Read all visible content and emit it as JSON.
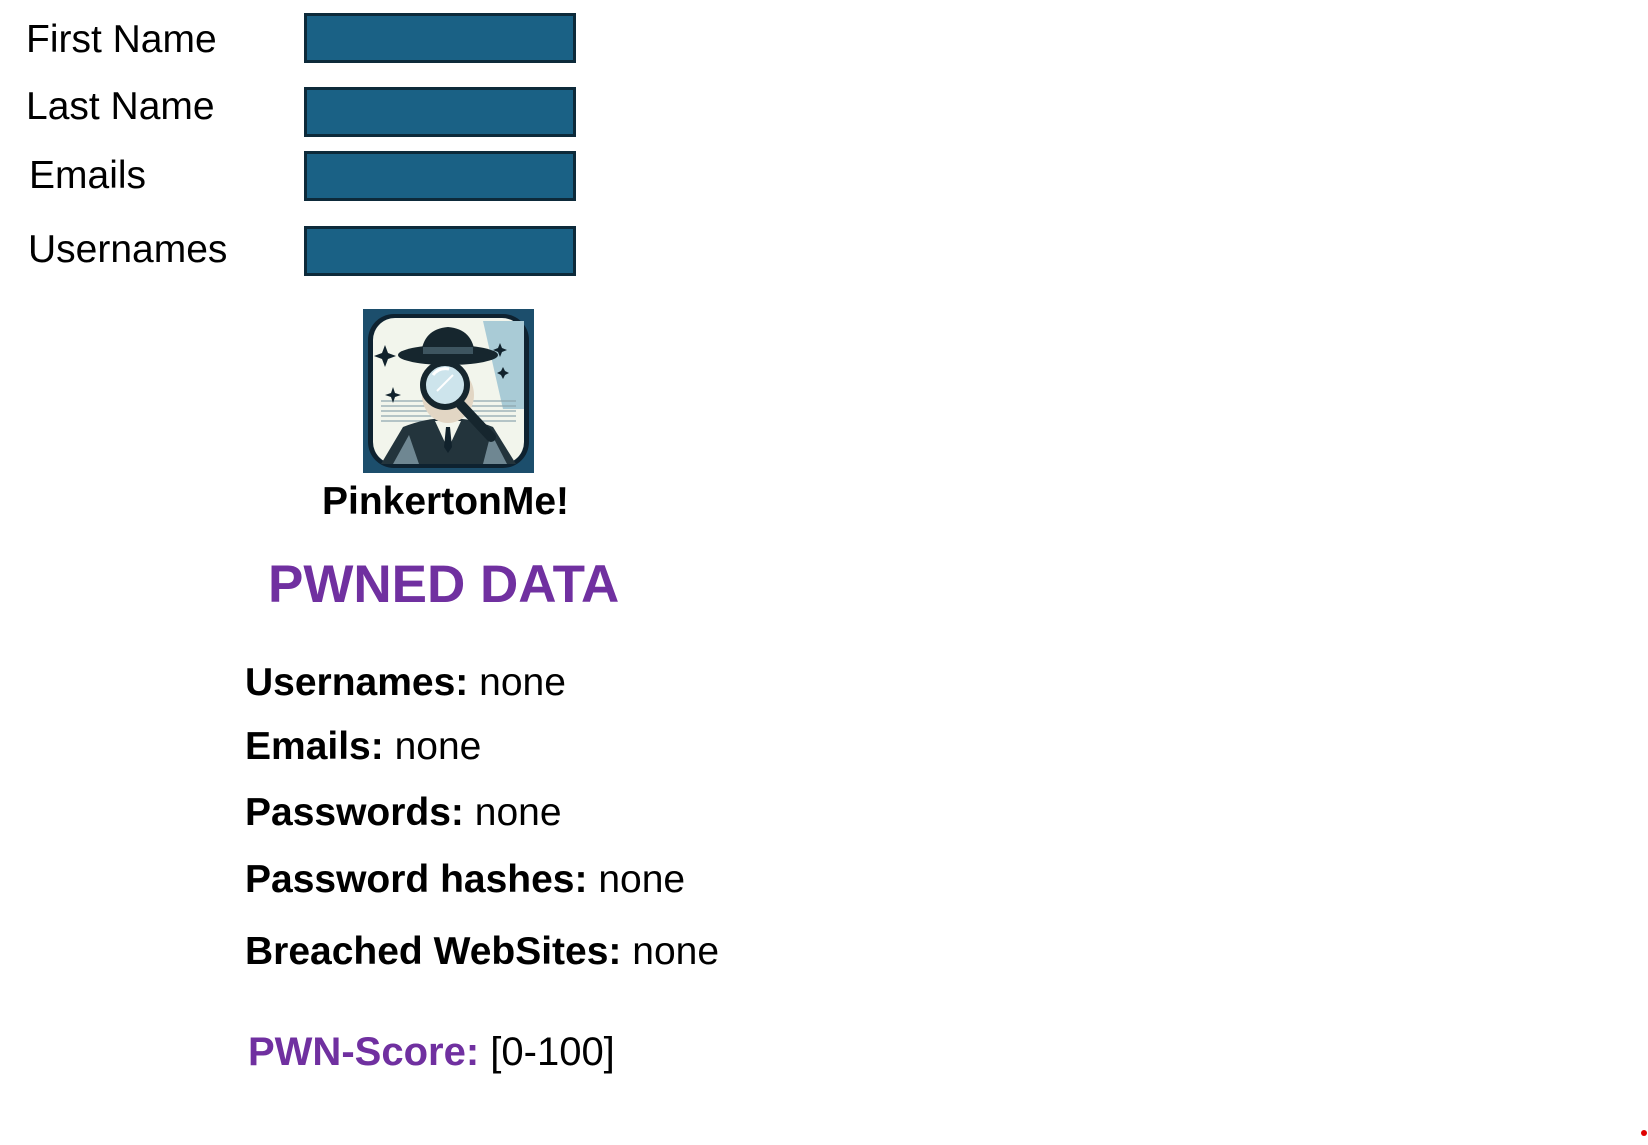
{
  "form": {
    "fields": [
      {
        "label": "First Name",
        "value": ""
      },
      {
        "label": "Last Name",
        "value": ""
      },
      {
        "label": "Emails",
        "value": ""
      },
      {
        "label": "Usernames",
        "value": ""
      }
    ]
  },
  "brand": {
    "logo_icon": "detective-magnifier-icon",
    "app_name": "PinkertonMe!"
  },
  "results": {
    "title": "PWNED DATA",
    "rows": [
      {
        "label": "Usernames:",
        "value": "none"
      },
      {
        "label": "Emails:",
        "value": "none"
      },
      {
        "label": "Passwords:",
        "value": "none"
      },
      {
        "label": "Password hashes:",
        "value": "none"
      },
      {
        "label": "Breached WebSites:",
        "value": "none"
      }
    ],
    "score": {
      "label": "PWN-Score:",
      "value": "[0-100]"
    }
  },
  "colors": {
    "input_fill": "#1a6185",
    "input_border": "#0d2a3a",
    "accent_purple": "#7030a0",
    "marker_red": "#e00000"
  }
}
